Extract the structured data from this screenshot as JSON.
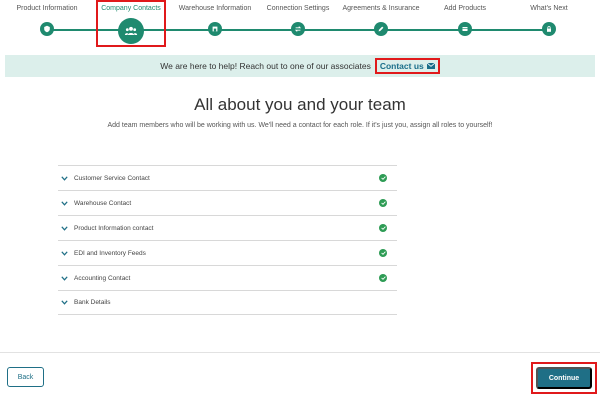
{
  "stepper": {
    "steps": [
      {
        "label": "Product Information",
        "icon": "shield-icon"
      },
      {
        "label": "Company Contacts",
        "icon": "people-icon"
      },
      {
        "label": "Warehouse Information",
        "icon": "warehouse-icon"
      },
      {
        "label": "Connection Settings",
        "icon": "swap-icon"
      },
      {
        "label": "Agreements & Insurance",
        "icon": "pencil-icon"
      },
      {
        "label": "Add Products",
        "icon": "box-icon"
      },
      {
        "label": "What's Next",
        "icon": "lock-icon"
      }
    ],
    "active_index": 1,
    "accent_color": "#1f8a6f"
  },
  "banner": {
    "text": "We are here to help! Reach out to one of our associates",
    "link_label": "Contact us",
    "link_icon": "mail-icon"
  },
  "main": {
    "title": "All about you and your team",
    "subtitle": "Add team members who will be working with us. We'll need a contact for each role. If it's just you, assign all roles to yourself!"
  },
  "contacts": {
    "items": [
      {
        "label": "Customer Service Contact",
        "complete": true
      },
      {
        "label": "Warehouse Contact",
        "complete": true
      },
      {
        "label": "Product Information contact",
        "complete": true
      },
      {
        "label": "EDI and Inventory Feeds",
        "complete": true
      },
      {
        "label": "Accounting Contact",
        "complete": true
      },
      {
        "label": "Bank Details",
        "complete": false
      }
    ]
  },
  "footer": {
    "back_label": "Back",
    "continue_label": "Continue",
    "button_color": "#1f6f86"
  }
}
